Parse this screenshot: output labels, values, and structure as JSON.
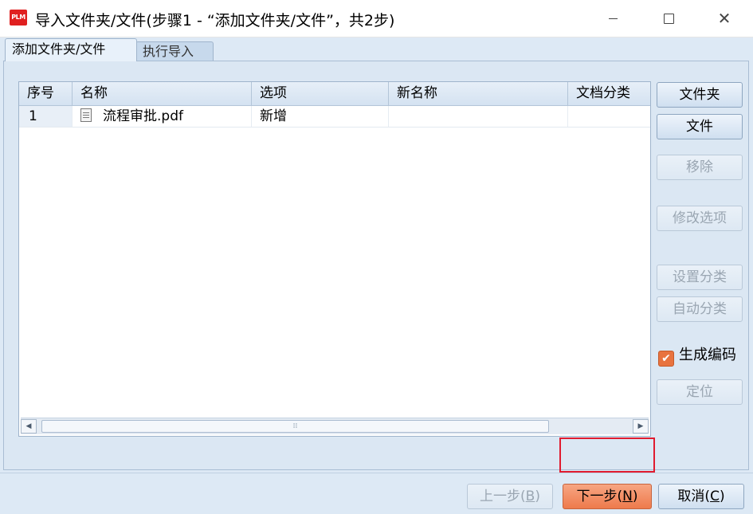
{
  "window": {
    "logo_text": "PLM",
    "title": "导入文件夹/文件(步骤1 - “添加文件夹/文件”，共2步)",
    "close_glyph": "✕"
  },
  "tabs": [
    {
      "label": "添加文件夹/文件",
      "active": true
    },
    {
      "label": "执行导入",
      "active": false
    }
  ],
  "table": {
    "columns": [
      "序号",
      "名称",
      "选项",
      "新名称",
      "文档分类"
    ],
    "rows": [
      {
        "seq": "1",
        "name": "流程审批.pdf",
        "option": "新增",
        "new_name": "",
        "category": ""
      }
    ],
    "scroll": {
      "left_arrow": "◀",
      "right_arrow": "▶",
      "thumb_grip": "⁞⁞"
    }
  },
  "side_buttons": {
    "folder": "文件夹",
    "file": "文件",
    "remove": "移除",
    "modify_option": "修改选项",
    "set_category": "设置分类",
    "auto_category": "自动分类",
    "generate_code_label": "生成编码",
    "generate_code_checked": true,
    "check_glyph": "✔",
    "locate": "定位"
  },
  "footer": {
    "prev": "上一步(",
    "prev_key": "B",
    "next": "下一步(",
    "next_key": "N",
    "cancel": "取消(",
    "cancel_key": "C",
    "close_paren": ")"
  },
  "colors": {
    "accent_next": "#ee7a4c",
    "highlight_border": "#e01b2f",
    "checkbox": "#e8733f"
  }
}
